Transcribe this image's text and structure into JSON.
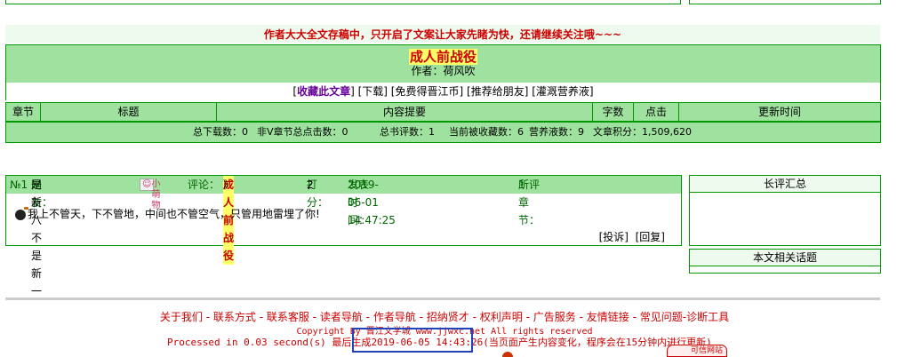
{
  "notice": "作者大大全文存稿中，只开启了文案让大家先睹为快，还请继续关注哦~~~",
  "book": {
    "title": "成人前战役",
    "author": "作者：荷风吹"
  },
  "links": {
    "favorite": "收藏此文章",
    "download": "下载",
    "free_coins": "免费得晋江币",
    "recommend": "推荐给朋友",
    "nutrient": "灌溉营养液"
  },
  "table_headers": [
    "章节",
    "标题",
    "内容提要",
    "字数",
    "点击",
    "更新时间"
  ],
  "stats": {
    "total_downloads": "总下载数：0",
    "nonv_clicks": "非V章节总点击数：0",
    "review_count": "总书评数：1",
    "collected": "当前被收藏数：6",
    "nutrient_count": "营养液数：9",
    "score": "文章积分：1,509,620"
  },
  "comment": {
    "number": "№1",
    "user_prefix": "网友：",
    "username": "是新八不是新一",
    "badge": "小萌物",
    "review_label": "评论：",
    "book_open": "《",
    "book_name": "成人前战役",
    "book_close": "》",
    "rating_label": "打分：",
    "rating": "2",
    "time_label": "发表时间：",
    "time": "2019-06-01 14:47:25",
    "chapter_label": "所评章节：",
    "chapter": "1",
    "text": "我上不管天，下不管地，中间也不管空气，只管用地雷埋了你!",
    "report": "[投诉]",
    "reply": "[回复]"
  },
  "sidebar": {
    "long_reviews": "长评汇总",
    "related_topics": "本文相关话题"
  },
  "footer": {
    "links": [
      "关于我们",
      "联系方式",
      "联系客服",
      "读者导航",
      "作者导航",
      "招纳贤才",
      "权利声明",
      "广告服务",
      "友情链接",
      "常见问题",
      "诊断工具"
    ],
    "copyright": "Copyright By 晋江文学城 www.jjwxc.net All rights reserved",
    "processed": "Processed in 0.03 second(s) 最后生成",
    "generated_time": "2019-06-05 14:43:26",
    "note": "(当页面产生内容变化，程序会在15分钟内进行更新)",
    "badge_text": "可信网站"
  }
}
